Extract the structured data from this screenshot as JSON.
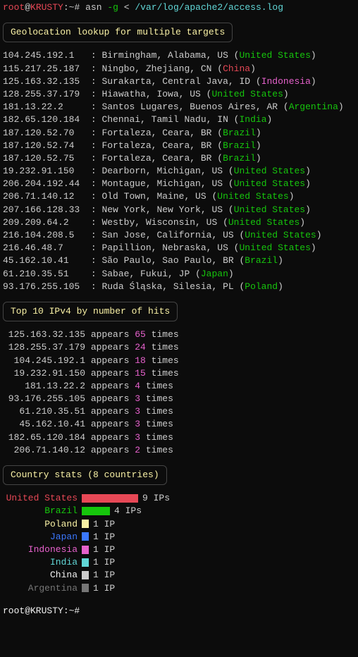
{
  "prompt": {
    "user": "root",
    "at": "@",
    "host": "KRUSTY",
    "cwd": "~",
    "sep": "#",
    "cmd": "asn",
    "flag": "-g",
    "redir": "<",
    "path": "/var/log/apache2/access.log"
  },
  "section1": {
    "title": "Geolocation lookup for multiple targets"
  },
  "geo": [
    {
      "ip": "104.245.192.1",
      "loc": "Birmingham, Alabama, US",
      "country": "United States",
      "cc": "green"
    },
    {
      "ip": "115.217.25.187",
      "loc": "Ningbo, Zhejiang, CN",
      "country": "China",
      "cc": "red"
    },
    {
      "ip": "125.163.32.135",
      "loc": "Surakarta, Central Java, ID",
      "country": "Indonesia",
      "cc": "magenta"
    },
    {
      "ip": "128.255.37.179",
      "loc": "Hiawatha, Iowa, US",
      "country": "United States",
      "cc": "green"
    },
    {
      "ip": "181.13.22.2",
      "loc": "Santos Lugares, Buenos Aires, AR",
      "country": "Argentina",
      "cc": "green"
    },
    {
      "ip": "182.65.120.184",
      "loc": "Chennai, Tamil Nadu, IN",
      "country": "India",
      "cc": "green"
    },
    {
      "ip": "187.120.52.70",
      "loc": "Fortaleza, Ceara, BR",
      "country": "Brazil",
      "cc": "green"
    },
    {
      "ip": "187.120.52.74",
      "loc": "Fortaleza, Ceara, BR",
      "country": "Brazil",
      "cc": "green"
    },
    {
      "ip": "187.120.52.75",
      "loc": "Fortaleza, Ceara, BR",
      "country": "Brazil",
      "cc": "green"
    },
    {
      "ip": "19.232.91.150",
      "loc": "Dearborn, Michigan, US",
      "country": "United States",
      "cc": "green"
    },
    {
      "ip": "206.204.192.44",
      "loc": "Montague, Michigan, US",
      "country": "United States",
      "cc": "green"
    },
    {
      "ip": "206.71.140.12",
      "loc": "Old Town, Maine, US",
      "country": "United States",
      "cc": "green"
    },
    {
      "ip": "207.166.128.33",
      "loc": "New York, New York, US",
      "country": "United States",
      "cc": "green"
    },
    {
      "ip": "209.209.64.2",
      "loc": "Westby, Wisconsin, US",
      "country": "United States",
      "cc": "green"
    },
    {
      "ip": "216.104.208.5",
      "loc": "San Jose, California, US",
      "country": "United States",
      "cc": "green"
    },
    {
      "ip": "216.46.48.7",
      "loc": "Papillion, Nebraska, US",
      "country": "United States",
      "cc": "green"
    },
    {
      "ip": "45.162.10.41",
      "loc": "São Paulo, Sao Paulo, BR",
      "country": "Brazil",
      "cc": "green"
    },
    {
      "ip": "61.210.35.51",
      "loc": "Sabae, Fukui, JP",
      "country": "Japan",
      "cc": "green"
    },
    {
      "ip": "93.176.255.105",
      "loc": "Ruda Śląska, Silesia, PL",
      "country": "Poland",
      "cc": "green"
    }
  ],
  "section2": {
    "title": "Top 10 IPv4 by number of hits"
  },
  "hits": [
    {
      "ip": "125.163.32.135",
      "count": "65"
    },
    {
      "ip": "128.255.37.179",
      "count": "24"
    },
    {
      "ip": "104.245.192.1",
      "count": "18"
    },
    {
      "ip": "19.232.91.150",
      "count": "15"
    },
    {
      "ip": "181.13.22.2",
      "count": "4"
    },
    {
      "ip": "93.176.255.105",
      "count": "3"
    },
    {
      "ip": "61.210.35.51",
      "count": "3"
    },
    {
      "ip": "45.162.10.41",
      "count": "3"
    },
    {
      "ip": "182.65.120.184",
      "count": "3"
    },
    {
      "ip": "206.71.140.12",
      "count": "2"
    }
  ],
  "section3": {
    "title": "Country stats (8 countries)"
  },
  "stats": [
    {
      "name": "United States",
      "color": "red",
      "bar": "bar-red",
      "w": 80,
      "count": "9 IPs"
    },
    {
      "name": "Brazil",
      "color": "green",
      "bar": "bar-green",
      "w": 40,
      "count": "4 IPs"
    },
    {
      "name": "Poland",
      "color": "yellow",
      "bar": "bar-yellow",
      "w": 10,
      "count": "1 IP"
    },
    {
      "name": "Japan",
      "color": "blue",
      "bar": "bar-blue",
      "w": 10,
      "count": "1 IP"
    },
    {
      "name": "Indonesia",
      "color": "magenta",
      "bar": "bar-magenta",
      "w": 10,
      "count": "1 IP"
    },
    {
      "name": "India",
      "color": "cyan",
      "bar": "bar-cyan",
      "w": 10,
      "count": "1 IP"
    },
    {
      "name": "China",
      "color": "white",
      "bar": "bar-white",
      "w": 10,
      "count": "1 IP"
    },
    {
      "name": "Argentina",
      "color": "gray",
      "bar": "bar-gray",
      "w": 10,
      "count": "1 IP"
    }
  ],
  "appears_word": "appears",
  "times_word": "times",
  "prompt2": "root@KRUSTY:~#"
}
